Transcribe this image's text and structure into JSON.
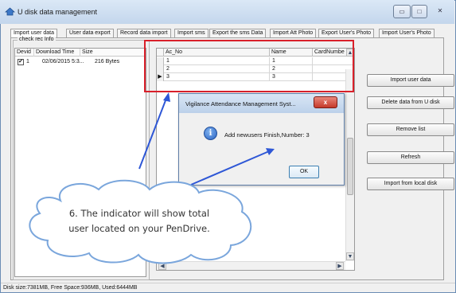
{
  "window": {
    "title": "U disk data management",
    "buttons": {
      "minimize": "▭",
      "maximize": "□",
      "close": "✕"
    }
  },
  "tabs": [
    {
      "label": "Import user data",
      "active": true
    },
    {
      "label": "User data export"
    },
    {
      "label": "Record data import"
    },
    {
      "label": "Import sms"
    },
    {
      "label": "Export the sms Data"
    },
    {
      "label": "Import Att Photo"
    },
    {
      "label": "Export User's Photo"
    },
    {
      "label": "Import User's Photo"
    }
  ],
  "check_rec": {
    "group_title": "check rec Info",
    "columns": [
      "Devid",
      "Download Time",
      "Size"
    ],
    "rows": [
      {
        "checked": true,
        "devid": "1",
        "download_time": "02/06/2015 5:3...",
        "size": "216 Bytes"
      }
    ]
  },
  "grid": {
    "columns": [
      "Ac_No",
      "Name",
      "CardNumbe"
    ],
    "rows": [
      {
        "ac_no": "1",
        "name": "1",
        "card": ""
      },
      {
        "ac_no": "2",
        "name": "2",
        "card": ""
      },
      {
        "ac_no": "3",
        "name": "3",
        "card": "",
        "current": true
      }
    ]
  },
  "actions": {
    "import_user_data": "Import user data",
    "delete_from_u_disk": "Delete data from U disk",
    "remove_list": "Remove list",
    "refresh": "Refresh",
    "import_from_local_disk": "Import from local disk"
  },
  "dialog": {
    "title": "Vigilance Attendance Management Syst...",
    "message": "Add newusers Finish,Number: 3",
    "ok": "OK",
    "close": "x",
    "icon": "info-icon"
  },
  "callout": {
    "line1": "6. The indicator will show total",
    "line2": "user located on your PenDrive."
  },
  "status": {
    "text": "Disk size:7381MB, Free Space:936MB, Used:6444MB"
  },
  "colors": {
    "highlight": "#d9202a",
    "arrow": "#2e57d6",
    "cloud_stroke": "#7aa6dc"
  }
}
